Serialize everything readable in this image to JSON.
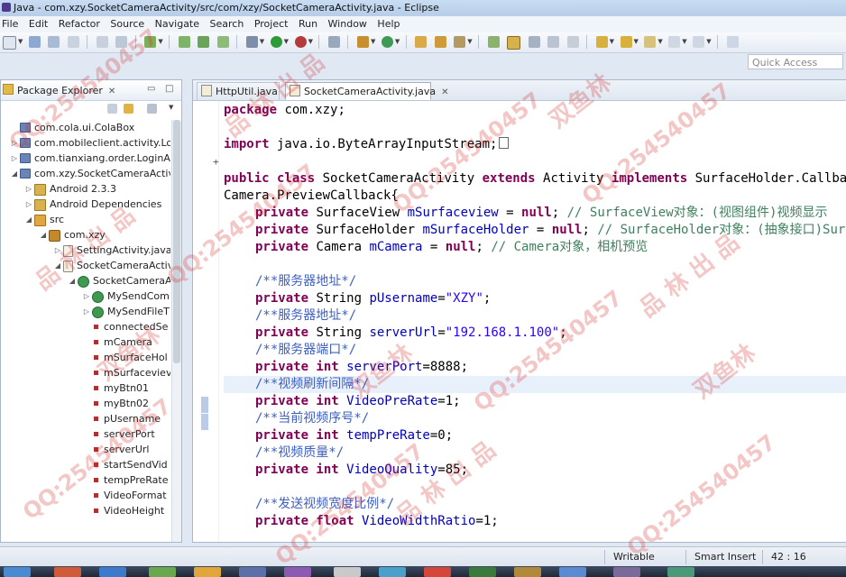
{
  "window": {
    "title": "Java - com.xzy.SocketCameraActivity/src/com/xzy/SocketCameraActivity.java - Eclipse"
  },
  "menu": {
    "items": [
      "File",
      "Edit",
      "Refactor",
      "Source",
      "Navigate",
      "Search",
      "Project",
      "Run",
      "Window",
      "Help"
    ]
  },
  "toolbar": {
    "quick_access_placeholder": "Quick Access"
  },
  "package_explorer": {
    "title": "Package Explorer",
    "close_glyph": "✕",
    "items": [
      {
        "label": "com.cola.ui.ColaBox",
        "twisty": "",
        "icon": "project"
      },
      {
        "label": "com.mobileclient.activity.Logi",
        "twisty": "▷",
        "icon": "project"
      },
      {
        "label": "com.tianxiang.order.LoginAct",
        "twisty": "▷",
        "icon": "project"
      },
      {
        "label": "com.xzy.SocketCameraActivit",
        "twisty": "◢",
        "icon": "project"
      },
      {
        "label": "Android 2.3.3",
        "twisty": "▷",
        "icon": "library"
      },
      {
        "label": "Android Dependencies",
        "twisty": "▷",
        "icon": "library"
      },
      {
        "label": "src",
        "twisty": "◢",
        "icon": "source-folder"
      },
      {
        "label": "com.xzy",
        "twisty": "◢",
        "icon": "package"
      },
      {
        "label": "SettingActivity.java",
        "twisty": "▷",
        "icon": "java-file"
      },
      {
        "label": "SocketCameraActiv",
        "twisty": "◢",
        "icon": "java-file"
      },
      {
        "label": "SocketCameraA",
        "twisty": "◢",
        "icon": "class"
      },
      {
        "label": "MySendCom",
        "twisty": "▷",
        "icon": "class"
      },
      {
        "label": "MySendFileT",
        "twisty": "▷",
        "icon": "class"
      },
      {
        "label": "connectedSe",
        "twisty": "",
        "icon": "field"
      },
      {
        "label": "mCamera",
        "twisty": "",
        "icon": "field"
      },
      {
        "label": "mSurfaceHol",
        "twisty": "",
        "icon": "field"
      },
      {
        "label": "mSurfaceviev",
        "twisty": "",
        "icon": "field"
      },
      {
        "label": "myBtn01",
        "twisty": "",
        "icon": "field"
      },
      {
        "label": "myBtn02",
        "twisty": "",
        "icon": "field"
      },
      {
        "label": "pUsername",
        "twisty": "",
        "icon": "field"
      },
      {
        "label": "serverPort",
        "twisty": "",
        "icon": "field"
      },
      {
        "label": "serverUrl",
        "twisty": "",
        "icon": "field"
      },
      {
        "label": "startSendVid",
        "twisty": "",
        "icon": "field"
      },
      {
        "label": "tempPreRate",
        "twisty": "",
        "icon": "field"
      },
      {
        "label": "VideoFormat",
        "twisty": "",
        "icon": "field"
      },
      {
        "label": "VideoHeight",
        "twisty": "",
        "icon": "field"
      }
    ]
  },
  "editor": {
    "tabs": [
      {
        "label": "HttpUtil.java",
        "active": false,
        "close": ""
      },
      {
        "label": "SocketCameraActivity.java",
        "active": true,
        "close": "✕"
      }
    ],
    "code": {
      "l1": {
        "kw": "package",
        "rest": " com.xzy;"
      },
      "l2": {
        "kw": "import",
        "rest": " java.io.ByteArrayInputStream;"
      },
      "l3": {
        "kw1": "public class",
        "mid1": " SocketCameraActivity ",
        "kw2": "extends",
        "mid2": " Activity ",
        "kw3": "implements",
        "rest": " SurfaceHolder.Callback,"
      },
      "l4": {
        "text": "Camera.PreviewCallback{"
      },
      "l5": {
        "kw": "private",
        "type": " SurfaceView ",
        "field": "mSurfaceview",
        "eq": " = ",
        "kw2": "null",
        "semi": "; ",
        "comment": "// SurfaceView对象：(视图组件)视频显示"
      },
      "l6": {
        "kw": "private",
        "type": " SurfaceHolder ",
        "field": "mSurfaceHolder",
        "eq": " = ",
        "kw2": "null",
        "semi": "; ",
        "comment": "// SurfaceHolder对象：(抽象接口)SurfaceView支持类"
      },
      "l7": {
        "kw": "private",
        "type": " Camera ",
        "field": "mCamera",
        "eq": " = ",
        "kw2": "null",
        "semi": "; ",
        "comment": "// Camera对象，相机预览"
      },
      "l8": {
        "doc": "/**服务器地址*/"
      },
      "l9": {
        "kw": "private",
        "type": " String ",
        "field": "pUsername",
        "eq": "=",
        "str": "\"XZY\"",
        "semi": ";"
      },
      "l10": {
        "doc": "/**服务器地址*/"
      },
      "l11": {
        "kw": "private",
        "type": " String ",
        "field": "serverUrl",
        "eq": "=",
        "str": "\"192.168.1.100\"",
        "semi": ";"
      },
      "l12": {
        "doc": "/**服务器端口*/"
      },
      "l13": {
        "kw": "private int",
        "field": " serverPort",
        "eq": "=8888;"
      },
      "l14": {
        "doc": "/**视频刷新间隔*/"
      },
      "l15": {
        "kw": "private int",
        "field": " VideoPreRate",
        "eq": "=1;"
      },
      "l16": {
        "doc": "/**当前视频序号*/"
      },
      "l17": {
        "kw": "private int",
        "field": " tempPreRate",
        "eq": "=0;"
      },
      "l18": {
        "doc": "/**视频质量*/"
      },
      "l19": {
        "kw": "private int",
        "field": " VideoQuality",
        "eq": "=85;"
      },
      "l20": {
        "doc": "/**发送视频宽度比例*/"
      },
      "l21": {
        "kw": "private float",
        "field": " VideoWidthRatio",
        "eq": "=1;"
      }
    }
  },
  "status": {
    "writable": "Writable",
    "insert_mode": "Smart Insert",
    "position": "42 : 16"
  },
  "watermark": {
    "qq": "QQ:254540457",
    "shop": "双鱼林",
    "chars": "品 林 出 品"
  },
  "colors": {
    "keyword": "#7f0055",
    "string": "#2a00ff",
    "field": "#0000c0",
    "comment": "#3f7f5f",
    "javadoc": "#3f5fbf"
  }
}
